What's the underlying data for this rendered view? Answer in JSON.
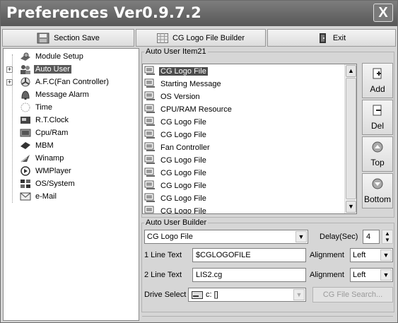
{
  "window": {
    "title": "Preferences Ver0.9.7.2",
    "close_label": "X"
  },
  "toolbar": {
    "section_save": "Section Save",
    "cg_logo_builder": "CG Logo File Builder",
    "exit": "Exit"
  },
  "tree": {
    "items": [
      {
        "label": "Module Setup",
        "icon": "gear-puzzle-icon"
      },
      {
        "label": "Auto User",
        "icon": "users-icon"
      },
      {
        "label": "A.F.C(Fan Controller)",
        "icon": "fan-icon"
      },
      {
        "label": "Message Alarm",
        "icon": "bell-icon"
      },
      {
        "label": "Time",
        "icon": "clock-icon"
      },
      {
        "label": "R.T.Clock",
        "icon": "chip-clock-icon"
      },
      {
        "label": "Cpu/Ram",
        "icon": "cpu-ram-icon"
      },
      {
        "label": "MBM",
        "icon": "mbm-icon"
      },
      {
        "label": "Winamp",
        "icon": "winamp-icon"
      },
      {
        "label": "WMPlayer",
        "icon": "media-player-icon"
      },
      {
        "label": "OS/System",
        "icon": "os-system-icon"
      },
      {
        "label": "e-Mail",
        "icon": "email-icon"
      }
    ]
  },
  "auto_user_item": {
    "legend": "Auto User Item21",
    "items": [
      "CG Logo File",
      "Starting Message",
      "OS Version",
      "CPU/RAM Resource",
      "CG Logo File",
      "CG Logo File",
      "Fan Controller",
      "CG Logo File",
      "CG Logo File",
      "CG Logo File",
      "CG Logo File",
      "CG Logo File"
    ],
    "buttons": {
      "add": "Add",
      "del": "Del",
      "top": "Top",
      "bottom": "Bottom"
    }
  },
  "builder": {
    "legend": "Auto User Builder",
    "type_value": "CG Logo File",
    "delay_label": "Delay(Sec)",
    "delay_value": "4",
    "line1_label": "1 Line Text",
    "line1_value": "$CGLOGOFILE",
    "line2_label": "2 Line Text",
    "line2_value": "LIS2.cg",
    "align_label": "Alignment",
    "align1_value": "Left",
    "align2_value": "Left",
    "drive_label": "Drive Select",
    "drive_value": "c: []",
    "cg_search": "CG File Search..."
  }
}
